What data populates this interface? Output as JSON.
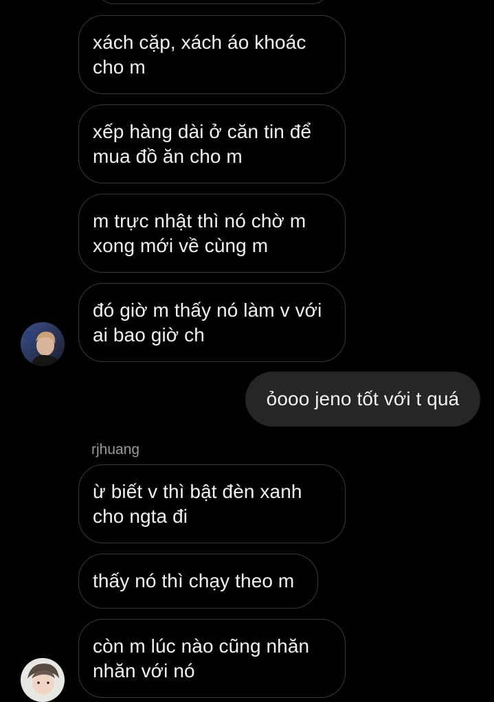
{
  "conversation": {
    "partner_name": "rjhuang",
    "messages_top": [
      {
        "text": "xách cặp, xách áo khoác cho m"
      },
      {
        "text": "xếp hàng dài ở căn tin để mua đồ ăn cho m"
      },
      {
        "text": "m trực nhật thì nó chờ m xong mới về cùng m"
      },
      {
        "text": "đó giờ m thấy nó làm v với ai bao giờ ch"
      }
    ],
    "outgoing": {
      "text": "ỏooo jeno tốt với t quá"
    },
    "messages_bottom": [
      {
        "text": "ừ biết v thì bật đèn xanh cho ngta đi"
      },
      {
        "text": "thấy nó thì chạy theo m"
      },
      {
        "text": "còn m lúc nào cũng nhăn nhăn với nó"
      }
    ]
  },
  "colors": {
    "background": "#000000",
    "incoming_border": "#3a3a3a",
    "outgoing_bubble": "#262626",
    "text": "#f2f2f2",
    "name": "#9a9a9a"
  },
  "icons": [
    "avatar-icon"
  ]
}
